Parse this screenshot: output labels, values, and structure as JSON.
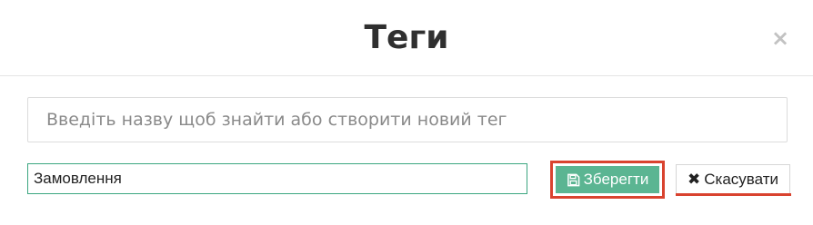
{
  "modal": {
    "title": "Теги",
    "close_icon": "close-icon"
  },
  "search": {
    "placeholder": "Введіть назву щоб знайти або створити новий тег",
    "value": ""
  },
  "tag_editor": {
    "value": "Замовлення",
    "save_label": "Зберегти",
    "save_icon": "floppy-disk-icon",
    "cancel_label": "Скасувати",
    "cancel_icon": "x-icon"
  },
  "colors": {
    "save_button": "#5bb592",
    "highlight": "#d9432f",
    "input_border": "#3ba680"
  }
}
